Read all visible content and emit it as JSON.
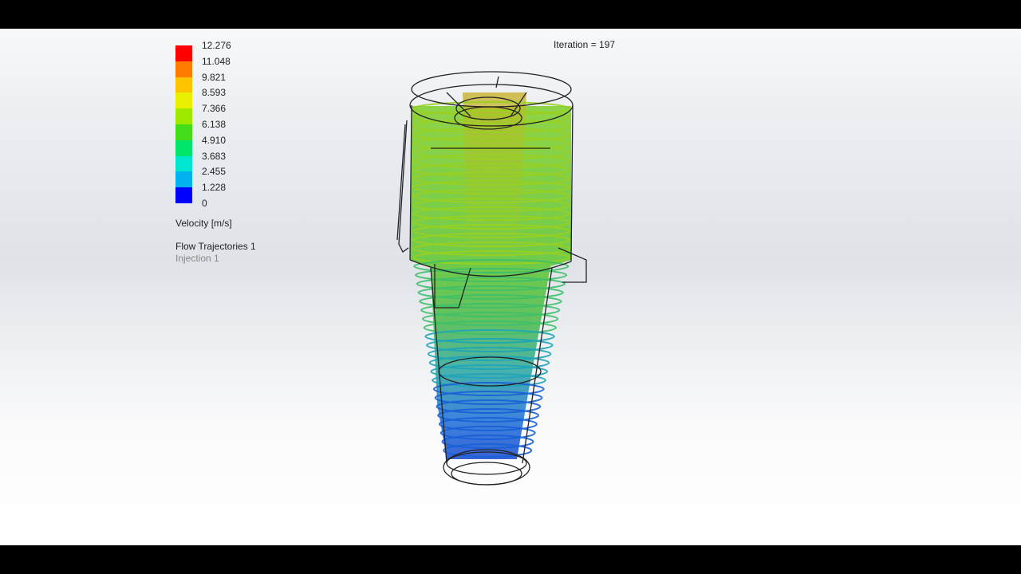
{
  "iteration_text": "Iteration = 197",
  "legend": {
    "ticks": [
      "12.276",
      "11.048",
      "9.821",
      "8.593",
      "7.366",
      "6.138",
      "4.910",
      "3.683",
      "2.455",
      "1.228",
      "0"
    ],
    "colors": [
      "#ff0000",
      "#ff7b00",
      "#ffc400",
      "#e9ef00",
      "#9fe800",
      "#43dd1a",
      "#00e56a",
      "#00e6cf",
      "#00b3ee",
      "#0d63ff",
      "#0000ff"
    ],
    "title": "Velocity [m/s]"
  },
  "series_label": "Flow Trajectories 1",
  "injection_label": "Injection 1"
}
